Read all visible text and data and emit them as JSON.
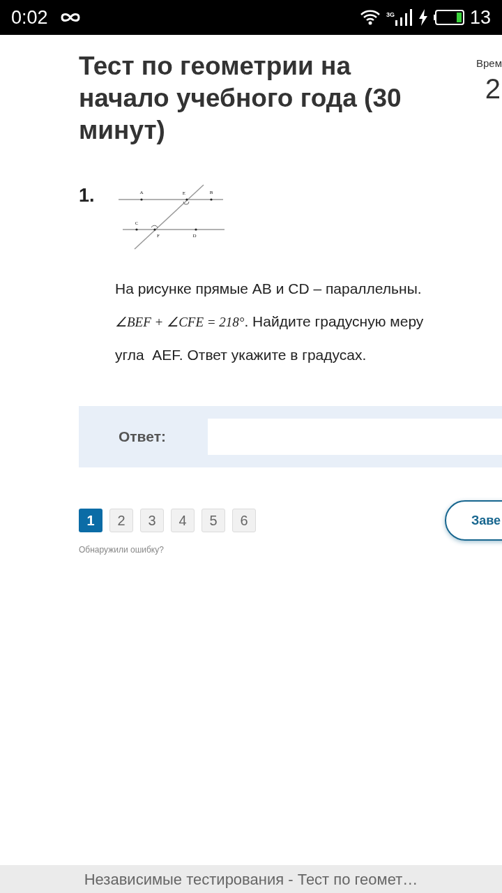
{
  "status_bar": {
    "time": "0:02",
    "network": "3G",
    "battery": "13"
  },
  "test": {
    "title": "Тест по геометрии на начало учебного года (30 минут)",
    "timer_label": "Врем",
    "timer_value": "2"
  },
  "question": {
    "number": "1.",
    "figure_labels": [
      "A",
      "E",
      "B",
      "C",
      "F",
      "D"
    ],
    "lines": [
      {
        "kind": "text",
        "text": "На рисунке прямые AB и CD – параллельны."
      },
      {
        "kind": "formula",
        "formula": "∠BEF + ∠CFE = 218°",
        "text": ". Найдите градусную меру"
      },
      {
        "kind": "text",
        "text": "угла  AEF. Ответ укажите в градусах."
      }
    ]
  },
  "answer": {
    "label": "Ответ:"
  },
  "pages": [
    {
      "label": "1",
      "selected": true
    },
    {
      "label": "2",
      "selected": false
    },
    {
      "label": "3",
      "selected": false
    },
    {
      "label": "4",
      "selected": false
    },
    {
      "label": "5",
      "selected": false
    },
    {
      "label": "6",
      "selected": false
    }
  ],
  "report_link": "Обнаружили ошибку?",
  "finish_button": "Заве",
  "browser_title": "Независимые тестирования - Тест по геомет…"
}
